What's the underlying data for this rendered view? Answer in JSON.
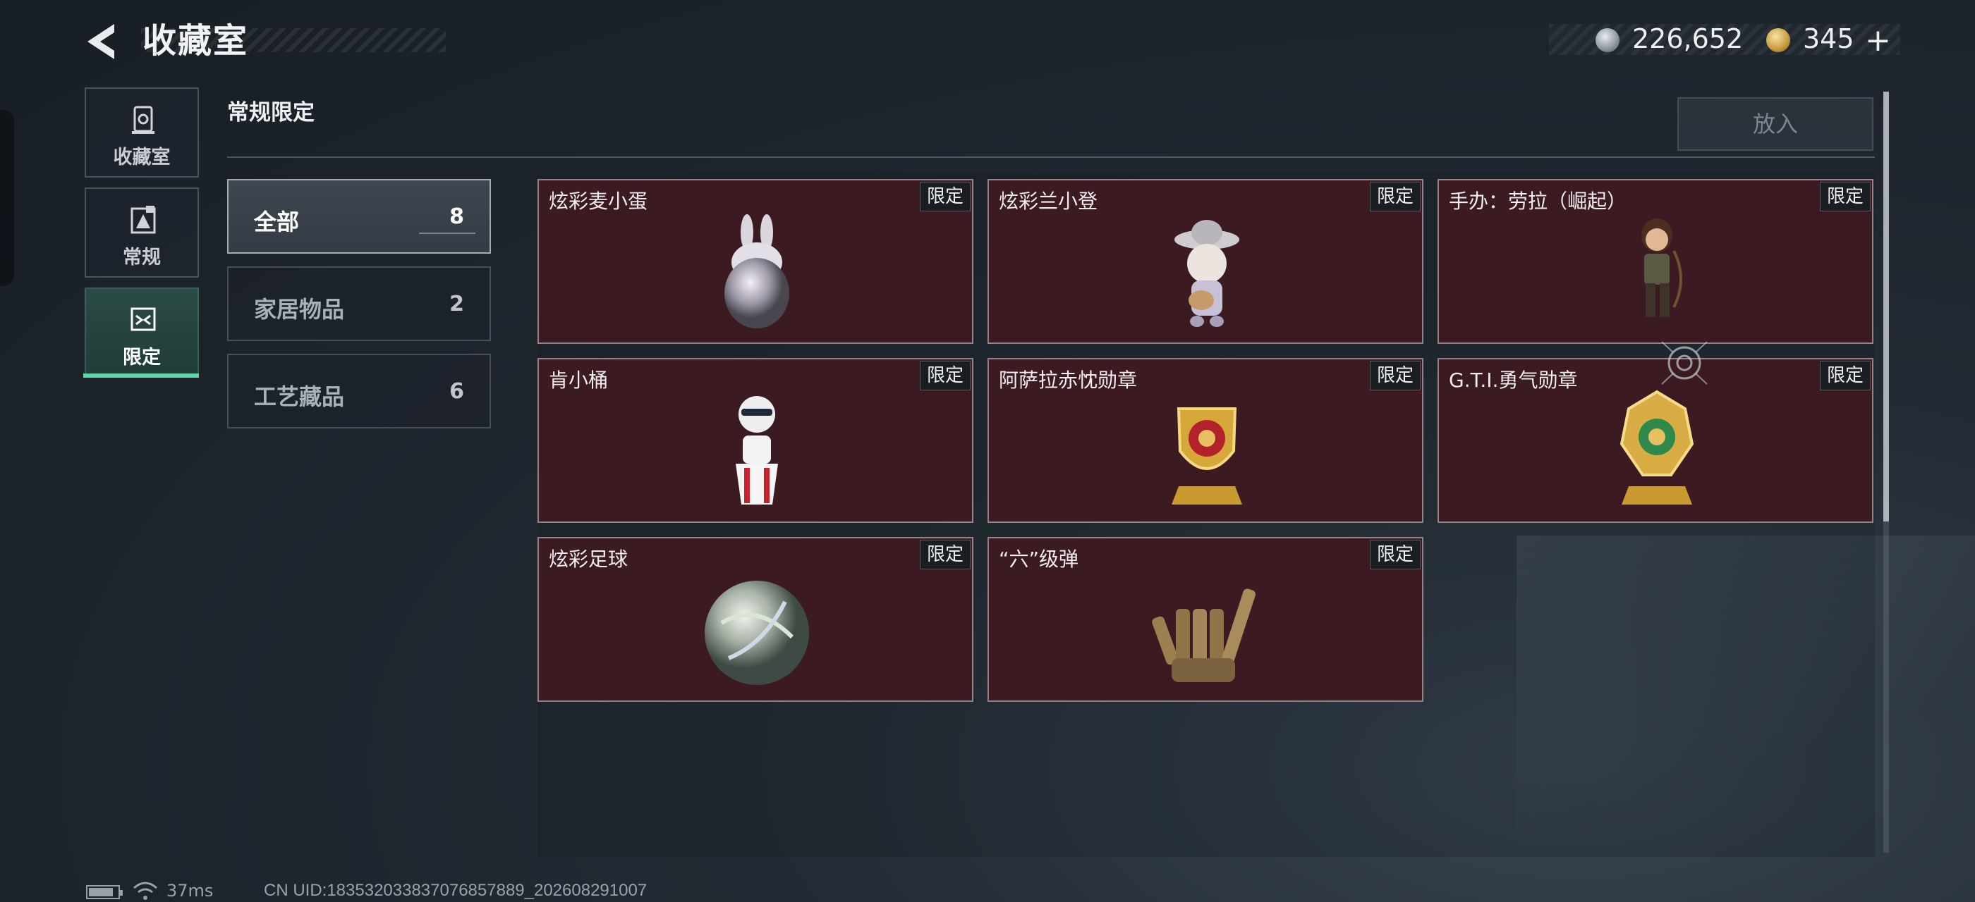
{
  "header": {
    "title": "收藏室",
    "currency_silver": "226,652",
    "currency_gold": "345",
    "plus_symbol": "+"
  },
  "rail": [
    {
      "label": "收藏室",
      "icon": "collection-icon"
    },
    {
      "label": "常规",
      "icon": "regular-icon"
    },
    {
      "label": "限定",
      "icon": "limited-icon"
    }
  ],
  "section": {
    "title": "常规限定",
    "put_button": "放入"
  },
  "categories": [
    {
      "label": "全部",
      "count": "8",
      "selected": true
    },
    {
      "label": "家居物品",
      "count": "2",
      "selected": false
    },
    {
      "label": "工艺藏品",
      "count": "6",
      "selected": false
    }
  ],
  "items": [
    {
      "name": "炫彩麦小蛋",
      "tag": "限定",
      "icon": "iridescent-bunny-egg-figure"
    },
    {
      "name": "炫彩兰小登",
      "tag": "限定",
      "icon": "sombrero-guitar-figure"
    },
    {
      "name": "手办：劳拉（崛起）",
      "tag": "限定",
      "icon": "lara-figure"
    },
    {
      "name": "肯小桶",
      "tag": "限定",
      "icon": "kfc-bucket-figure"
    },
    {
      "name": "阿萨拉赤忱勋章",
      "tag": "限定",
      "icon": "red-gold-medal"
    },
    {
      "name": "G.T.I.勇气勋章",
      "tag": "限定",
      "icon": "green-gold-medal"
    },
    {
      "name": "炫彩足球",
      "tag": "限定",
      "icon": "iridescent-ball"
    },
    {
      "name": "“六”级弹",
      "tag": "限定",
      "icon": "bullet-hand-sign"
    }
  ],
  "status": {
    "ping": "37ms",
    "uid": "CN UID:18353203383707685788​9_202608291007"
  },
  "colors": {
    "accent_green": "#5ed6a8",
    "card_bg": "#3b1b21"
  }
}
